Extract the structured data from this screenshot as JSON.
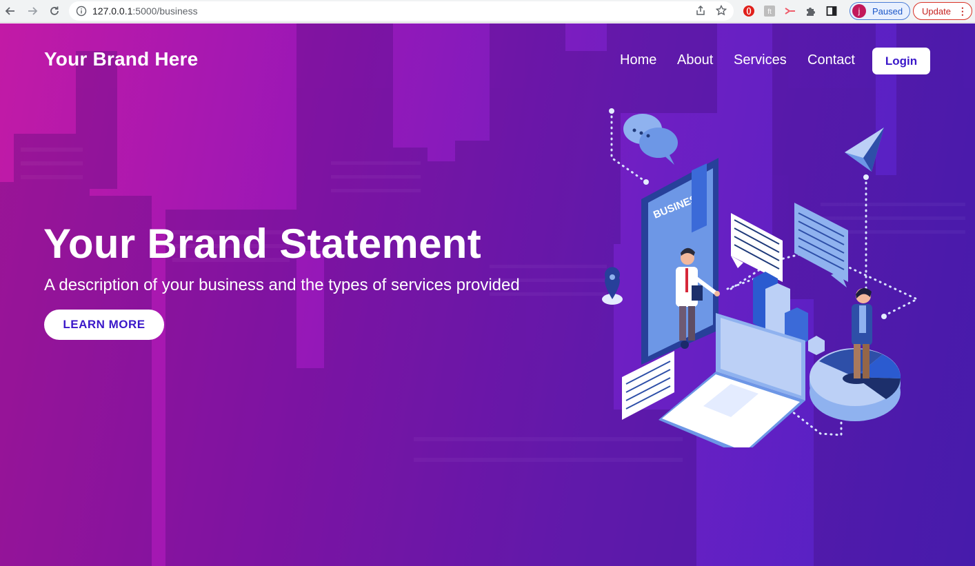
{
  "browser": {
    "url_host": "127.0.0.1",
    "url_rest": ":5000/business",
    "profile_initial": "j",
    "profile_label": "Paused",
    "update_label": "Update"
  },
  "site": {
    "brand": "Your Brand Here",
    "nav": {
      "home": "Home",
      "about": "About",
      "services": "Services",
      "contact": "Contact",
      "login": "Login"
    },
    "hero": {
      "headline": "Your Brand Statement",
      "description": "A description of your business and the types of services provided",
      "cta": "LEARN MORE"
    },
    "illustration": {
      "phone_text": "BUSINESS"
    }
  },
  "colors": {
    "gradient_start": "#c21aa6",
    "gradient_end": "#4c22c4",
    "button_text": "#3a17c9"
  }
}
